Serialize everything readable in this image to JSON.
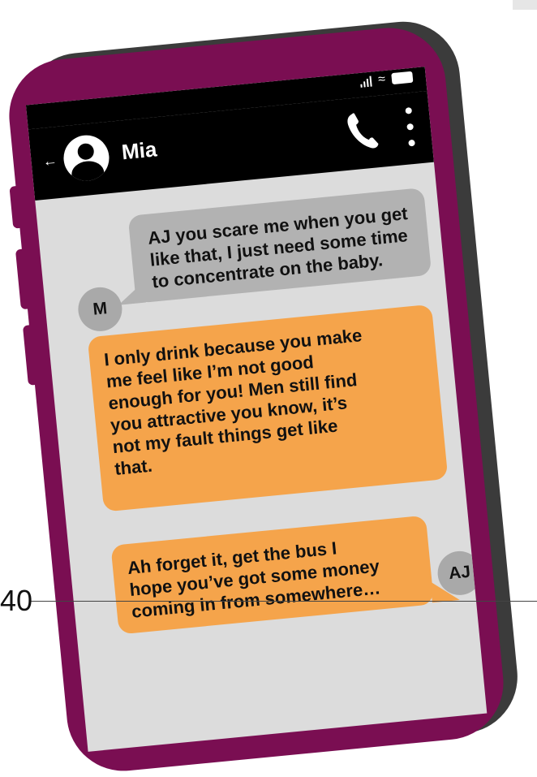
{
  "page": {
    "number": "40"
  },
  "status_bar": {
    "icons": [
      "signal-icon",
      "wifi-icon",
      "battery-icon"
    ]
  },
  "header": {
    "back_icon": "back-arrow-icon",
    "contact_name": "Mia",
    "call_icon": "phone-icon",
    "menu_icon": "more-vertical-icon"
  },
  "messages": [
    {
      "sender_initial": "M",
      "direction": "incoming",
      "lines": [
        "AJ you scare me when you get",
        "like that, I just need some time",
        "to concentrate on the baby."
      ]
    },
    {
      "sender_initial": "AJ",
      "direction": "outgoing",
      "lines": [
        "I only drink because you make",
        "me feel like I’m not good",
        "enough for you! Men still find",
        "you attractive you know, it’s",
        "not my fault things get like",
        "that."
      ]
    },
    {
      "sender_initial": "AJ",
      "direction": "outgoing",
      "lines": [
        "Ah forget it, get the bus I",
        "hope you’ve got some money",
        "coming in from somewhere…"
      ]
    }
  ],
  "colors": {
    "phone_frame": "#7a0e52",
    "phone_shadow": "#3b3b3b",
    "screen_bg": "#dcdcdc",
    "header_bg": "#000000",
    "incoming_bubble": "#b2b2b2",
    "outgoing_bubble": "#f5a44b",
    "avatar_circle": "#a9a9a9"
  }
}
